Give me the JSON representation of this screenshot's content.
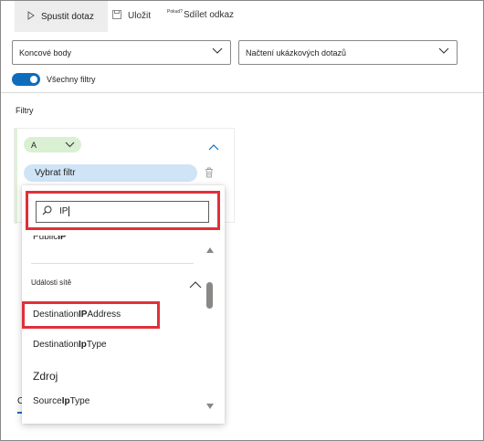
{
  "toolbar": {
    "run_label": "Spustit dotaz",
    "save_label": "Uložit",
    "share_prefix": "Pokud?",
    "share_label": "Sdílet odkaz"
  },
  "dropdowns": {
    "endpoints": "Koncové body",
    "sample_queries": "Načtení ukázkových dotazů"
  },
  "toggle": {
    "label": "Všechny filtry",
    "on": true
  },
  "filters": {
    "title": "Filtry",
    "operator": "A",
    "picker_label": "Vybrat filtr"
  },
  "popup": {
    "search_value": "IP",
    "public_item": {
      "prefix": "Public",
      "bold": "IP",
      "suffix": ""
    },
    "group_label": "Události sítě",
    "items": [
      {
        "prefix": "Destination",
        "bold": "IP",
        "suffix": "Address"
      },
      {
        "prefix": "Destination",
        "bold": "Ip",
        "suffix": "Type"
      }
    ],
    "section_label": "Zdroj",
    "source_item": {
      "prefix": "Source",
      "bold": "Ip",
      "suffix": "Type"
    }
  },
  "tab_fragment": "C",
  "colors": {
    "accent": "#0f6cbd",
    "highlight": "#e0303a",
    "operator_bg": "#d9f0d3",
    "picker_bg": "#cfe4f6"
  }
}
